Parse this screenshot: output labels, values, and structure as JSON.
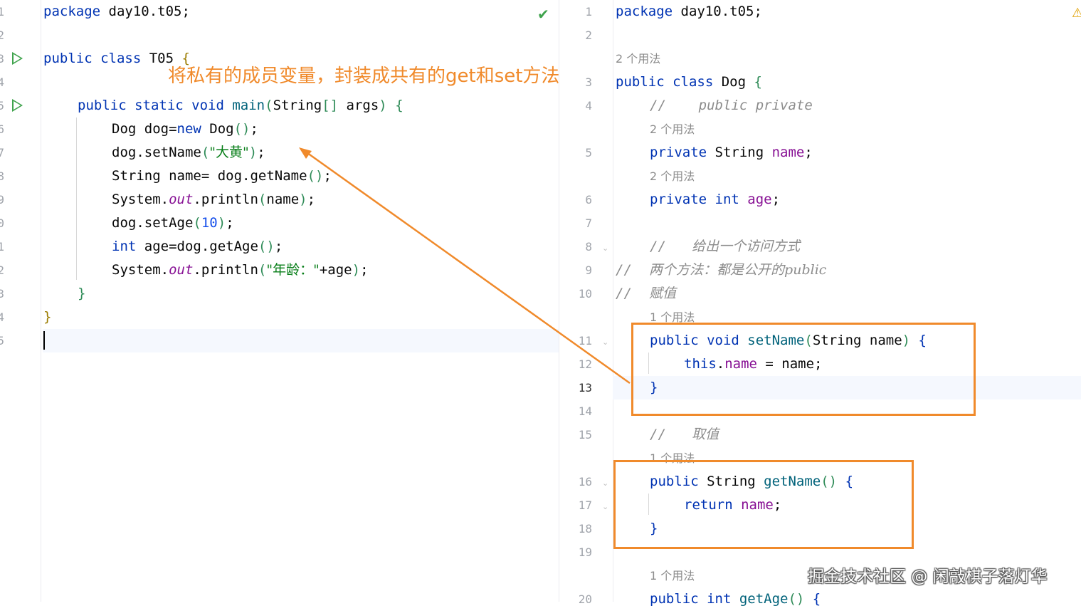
{
  "left_editor": {
    "line_numbers": [
      "1",
      "2",
      "3",
      "4",
      "5",
      "6",
      "7",
      "8",
      "9",
      "0",
      "1",
      "2",
      "3",
      "4",
      "5"
    ],
    "lines": {
      "l1": {
        "kw": "package",
        "rest": " day10.t05;"
      },
      "l3": {
        "kw1": "public",
        "kw2": " class",
        "name": " T05 ",
        "brace": "{"
      },
      "l5": {
        "kw": "public static void",
        "fn": " main",
        "p1": "(",
        "type": "String",
        "br": "[]",
        "arg": " args",
        "p2": ")",
        "brace": " {"
      },
      "l6": {
        "a": "Dog dog=",
        "kw": "new",
        "b": " Dog",
        "p": "()",
        "c": ";"
      },
      "l7": {
        "a": "dog.setName",
        "p1": "(",
        "str": "\"大黄\"",
        "p2": ")",
        "c": ";"
      },
      "l8": {
        "a": "String name= dog.getName",
        "p": "()",
        "c": ";"
      },
      "l9": {
        "a": "System.",
        "it": "out",
        "b": ".println",
        "p1": "(",
        "arg": "name",
        "p2": ")",
        "c": ";"
      },
      "l10": {
        "a": "dog.setAge",
        "p1": "(",
        "num": "10",
        "p2": ")",
        "c": ";"
      },
      "l11": {
        "kw": "int",
        "a": " age=dog.getAge",
        "p": "()",
        "c": ";"
      },
      "l12": {
        "a": "System.",
        "it": "out",
        "b": ".println",
        "p1": "(",
        "str": "\"年龄：\"",
        "rest": "+age",
        "p2": ")",
        "c": ";"
      },
      "l13": {
        "brace": "}"
      },
      "l14": {
        "brace": "}"
      }
    }
  },
  "right_editor": {
    "line_numbers": [
      "1",
      "2",
      "3",
      "4",
      "5",
      "6",
      "7",
      "8",
      "9",
      "10",
      "11",
      "12",
      "13",
      "14",
      "15",
      "16",
      "17",
      "18",
      "19",
      "20"
    ],
    "hints": {
      "usage2": "2 个用法",
      "usage1": "1 个用法"
    },
    "lines": {
      "r1": {
        "kw": "package",
        "rest": " day10.t05;"
      },
      "r3": {
        "kw": "public class",
        "name": " Dog ",
        "brace": "{"
      },
      "r4": {
        "slashes": "//",
        "cmt": "    public private"
      },
      "r5": {
        "kw": "private",
        "type": " String",
        "field": " name",
        "c": ";"
      },
      "r6": {
        "kw": "private int",
        "field": " age",
        "c": ";"
      },
      "r8": {
        "slashes": "//",
        "cmt": "      给出一个访问方式"
      },
      "r9": {
        "slashes": "//",
        "cmt": "    两个方法：都是公开的public"
      },
      "r10": {
        "slashes": "//",
        "cmt": "    赋值"
      },
      "r11": {
        "kw": "public void",
        "fn": " setName",
        "p1": "(",
        "args": "String name",
        "p2": ")",
        "brace": " {"
      },
      "r12": {
        "kw": "this",
        "dot": ".",
        "field": "name",
        "rest": " = name;"
      },
      "r13": {
        "brace": "}"
      },
      "r15": {
        "slashes": "//",
        "cmt": "      取值"
      },
      "r16": {
        "kw": "public",
        "type": " String",
        "fn": " getName",
        "p": "()",
        "brace": " {"
      },
      "r17": {
        "kw": "return",
        "field": " name",
        "c": ";"
      },
      "r18": {
        "brace": "}"
      },
      "r20": {
        "kw": "public int",
        "fn": " getAge",
        "p": "()",
        "brace": " {"
      }
    }
  },
  "annotation": {
    "text": "将私有的成员变量，封装成共有的get和set方法",
    "color": "#f08a2b"
  },
  "watermark": "掘金技术社区 @ 闲敲棋子落灯华",
  "icons": {
    "run": "run-icon",
    "check": "check-icon",
    "warning": "warning-icon"
  }
}
